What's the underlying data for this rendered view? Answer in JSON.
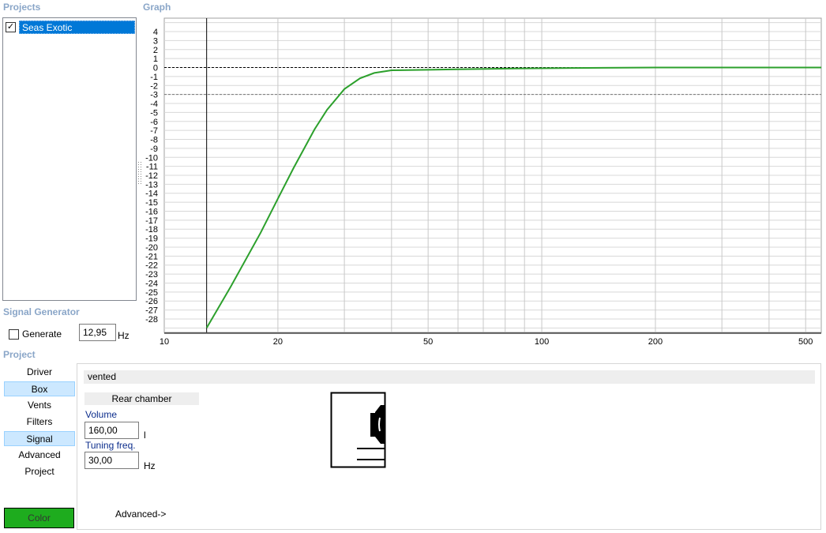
{
  "sections": {
    "projects": "Projects",
    "graph": "Graph",
    "signal_generator": "Signal Generator",
    "project": "Project"
  },
  "projects": [
    {
      "label": "Seas Exotic",
      "checked": true,
      "check_mark": "✓"
    }
  ],
  "signal_generator": {
    "generate_label": "Generate",
    "frequency": "12,95",
    "unit": "Hz",
    "checked": false
  },
  "nav": {
    "items": [
      "Driver",
      "Box",
      "Vents",
      "Filters",
      "Signal",
      "Advanced",
      "Project"
    ],
    "selected": [
      "Box",
      "Signal"
    ]
  },
  "panel": {
    "box_type": "vented",
    "rear_chamber": "Rear chamber",
    "volume": {
      "label": "Volume",
      "value": "160,00",
      "unit": "l"
    },
    "tuning": {
      "label": "Tuning freq.",
      "value": "30,00",
      "unit": "Hz"
    },
    "advanced_link": "Advanced->"
  },
  "color_button": {
    "label": "Color",
    "color": "#1eac1e"
  },
  "chart_data": {
    "type": "line",
    "title": "",
    "xlabel": "",
    "ylabel": "",
    "x_scale": "log",
    "xlim": [
      10,
      550
    ],
    "ylim": [
      -29.5,
      5.5
    ],
    "x_tick_labels": [
      10,
      20,
      50,
      100,
      200,
      500
    ],
    "x_minor_ticks": [
      30,
      40,
      60,
      70,
      80,
      90,
      300,
      400
    ],
    "y_ticks": [
      4,
      3,
      2,
      1,
      0,
      -1,
      -2,
      -3,
      -4,
      -5,
      -6,
      -7,
      -8,
      -9,
      -10,
      -11,
      -12,
      -13,
      -14,
      -15,
      -16,
      -17,
      -18,
      -19,
      -20,
      -21,
      -22,
      -23,
      -24,
      -25,
      -26,
      -27,
      -28
    ],
    "reference_lines": [
      0,
      -3
    ],
    "marker_x": 12.95,
    "grid": true,
    "series": [
      {
        "color": "#2ca02c",
        "x": [
          12.95,
          15,
          18,
          20,
          22,
          25,
          27,
          30,
          33,
          36,
          40,
          50,
          60,
          85,
          120,
          200,
          550
        ],
        "y": [
          -29,
          -24.4,
          -18.4,
          -14.6,
          -11.2,
          -6.9,
          -4.7,
          -2.4,
          -1.2,
          -0.6,
          -0.3,
          -0.25,
          -0.2,
          -0.1,
          -0.05,
          0,
          0
        ]
      }
    ]
  }
}
